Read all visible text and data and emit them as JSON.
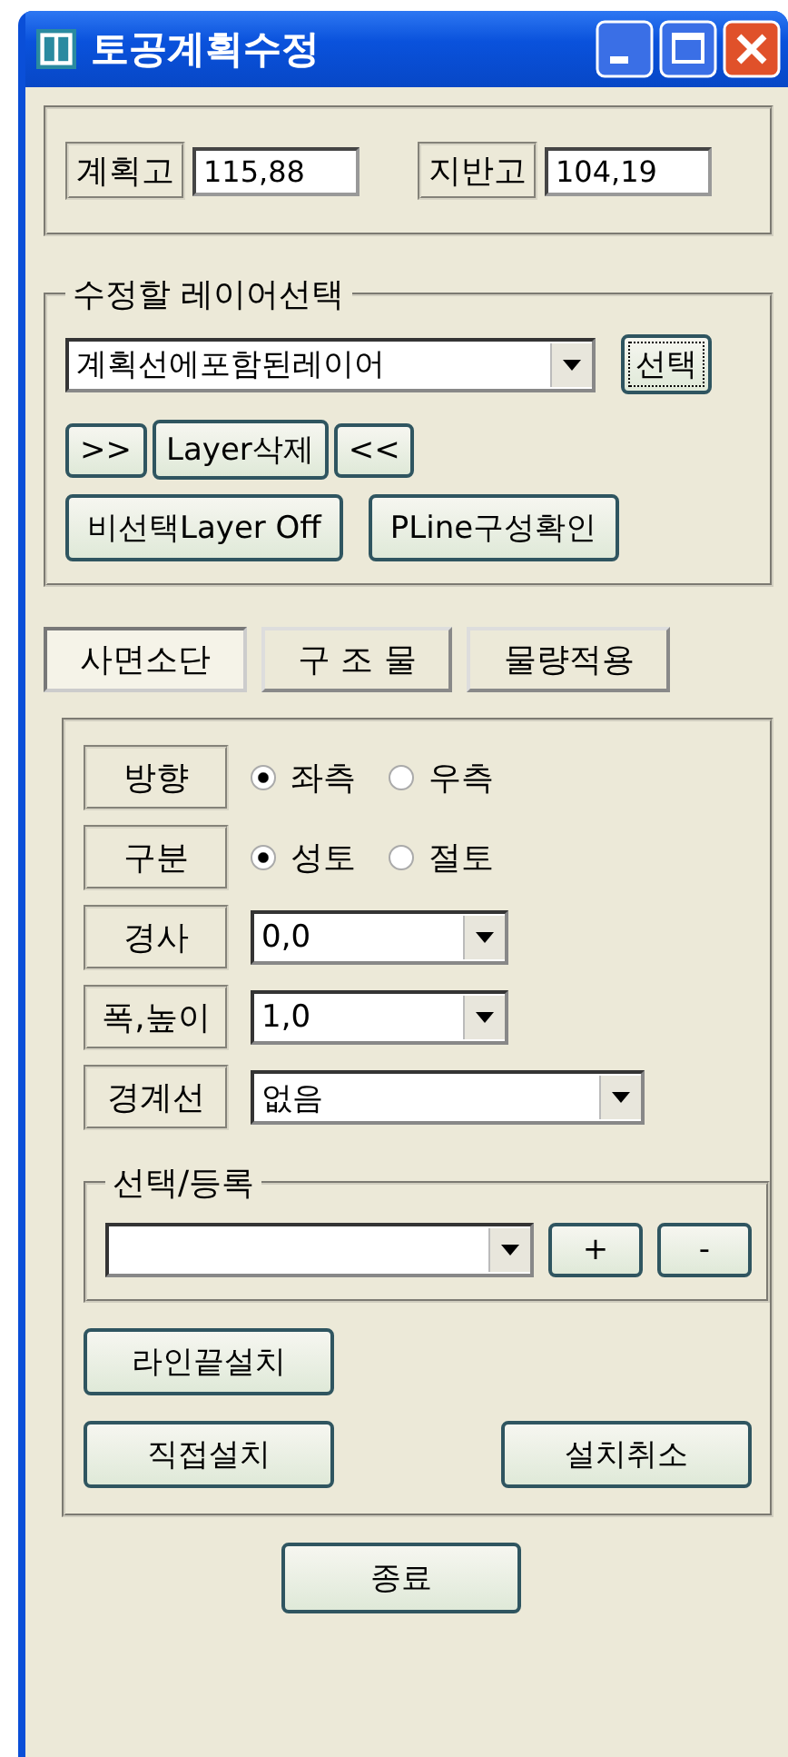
{
  "window": {
    "title": "토공계획수정"
  },
  "heights": [
    {
      "label": "계획고",
      "value": "115,88"
    },
    {
      "label": "지반고",
      "value": "104,19"
    }
  ],
  "layer_group": {
    "title": "수정할 레이어선택",
    "combo_value": "계획선에포함된레이어",
    "select_button": "선택",
    "buttons_row1": [
      ">>",
      "Layer삭제",
      "<<"
    ],
    "buttons_row2": [
      "비선택Layer Off",
      "PLine구성확인"
    ]
  },
  "tabs": [
    {
      "label": "사면소단",
      "selected": true
    },
    {
      "label": "구 조 물",
      "selected": false
    },
    {
      "label": "물량적용",
      "selected": false
    }
  ],
  "fields": [
    {
      "kind": "radio",
      "label": "방향",
      "options": [
        {
          "label": "좌측",
          "selected": true
        },
        {
          "label": "우측",
          "selected": false
        }
      ]
    },
    {
      "kind": "radio",
      "label": "구분",
      "options": [
        {
          "label": "성토",
          "selected": true
        },
        {
          "label": "절토",
          "selected": false
        }
      ]
    },
    {
      "kind": "combo",
      "label": "경사",
      "value": "0,0"
    },
    {
      "kind": "combo",
      "label": "폭,높이",
      "value": "1,0"
    },
    {
      "kind": "combo",
      "label": "경계선",
      "value": "없음"
    }
  ],
  "register_group": {
    "title": "선택/등록",
    "buttons": [
      "+",
      "-"
    ]
  },
  "buttons": [
    "라인끝설치",
    "직접설치",
    "설치취소"
  ],
  "close_button": "종료"
}
